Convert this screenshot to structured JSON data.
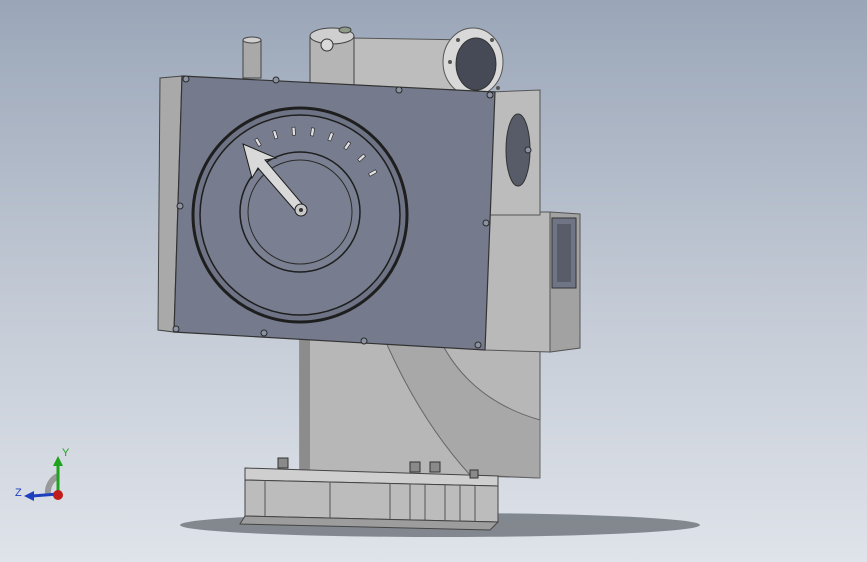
{
  "viewport": {
    "background_top": "#9aa6b8",
    "background_bottom": "#dfe3ea"
  },
  "model": {
    "face_plate_color": "#757b8d",
    "body_color": "#b2b2b2",
    "dark_edge_color": "#3a3a3a",
    "gauge": {
      "tick_count": 8,
      "pointer_shape": "arrow"
    }
  },
  "triad": {
    "x_label": "",
    "y_label": "Y",
    "z_label": "Z",
    "y_color": "#1fa31f",
    "z_color": "#1f3fbf",
    "x_color": "#c21b1b"
  }
}
